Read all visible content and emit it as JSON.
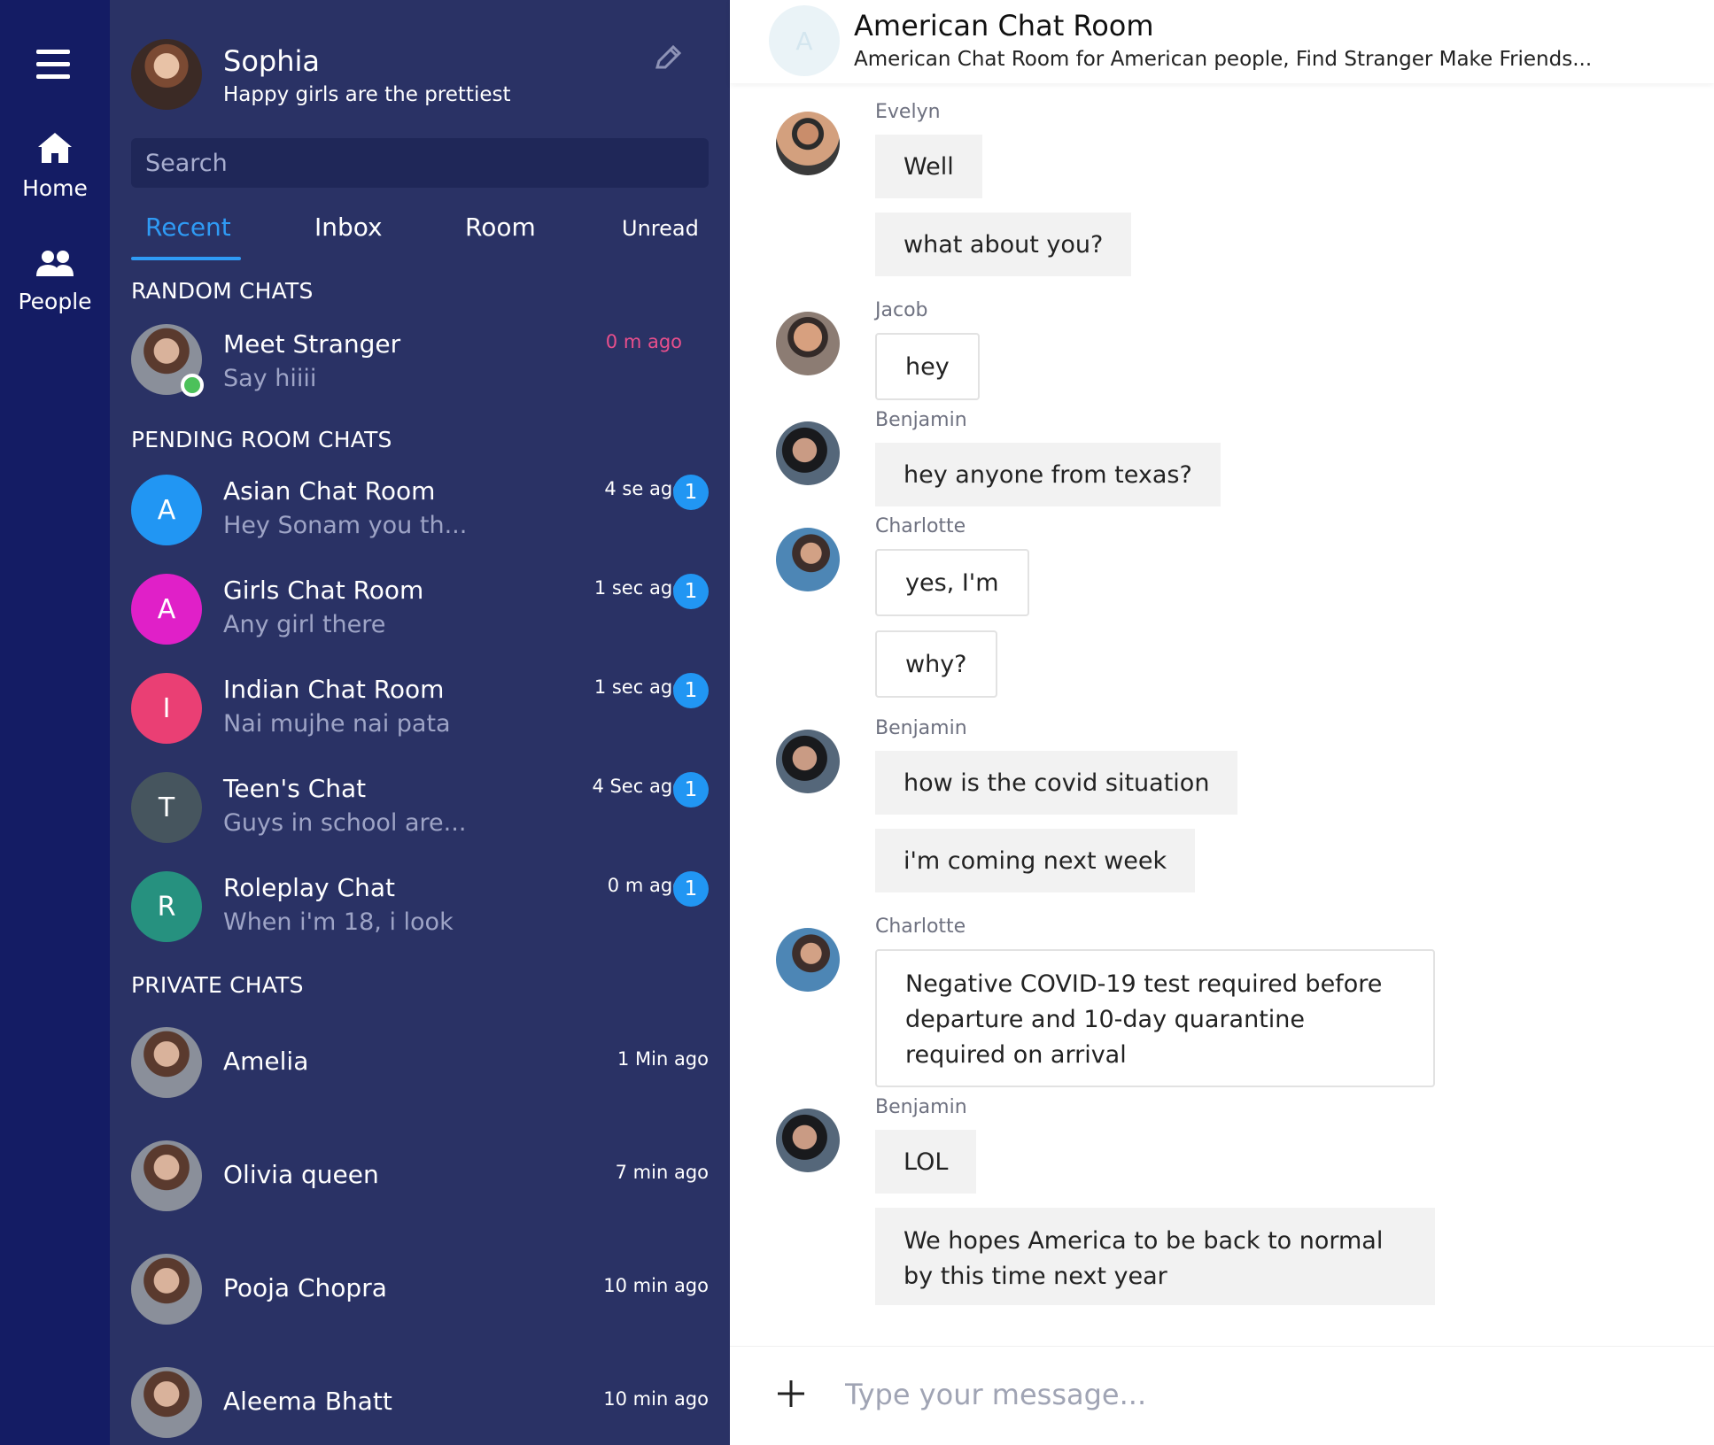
{
  "rail": {
    "home_label": "Home",
    "people_label": "People"
  },
  "profile": {
    "name": "Sophia",
    "status": "Happy girls are the prettiest"
  },
  "search": {
    "placeholder": "Search"
  },
  "tabs": [
    {
      "label": "Recent",
      "active": true
    },
    {
      "label": "Inbox",
      "active": false
    },
    {
      "label": "Room",
      "active": false
    },
    {
      "label": "Unread",
      "active": false
    }
  ],
  "sections": {
    "random": "RANDOM CHATS",
    "pending": "PENDING ROOM CHATS",
    "private": "PRIVATE CHATS"
  },
  "random_chats": [
    {
      "name": "Meet Stranger",
      "message": "Say hiiii",
      "time": "0 m ago",
      "online": true
    }
  ],
  "pending_chats": [
    {
      "initial": "A",
      "name": "Asian Chat Room",
      "message": "Hey Sonam you th...",
      "time": "4 se ago",
      "unread": "1",
      "color": "#2196f3"
    },
    {
      "initial": "A",
      "name": "Girls Chat Room",
      "message": "Any girl there",
      "time": "1 sec ago",
      "unread": "1",
      "color": "#e020c8"
    },
    {
      "initial": "I",
      "name": "Indian Chat Room",
      "message": "Nai mujhe nai pata",
      "time": "1 sec ago",
      "unread": "1",
      "color": "#ea3f74"
    },
    {
      "initial": "T",
      "name": "Teen's Chat",
      "message": "Guys in school are...",
      "time": "4 Sec ago",
      "unread": "1",
      "color": "#46555e"
    },
    {
      "initial": "R",
      "name": "Roleplay Chat",
      "message": "When i'm 18, i look",
      "time": "0 m ago",
      "unread": "1",
      "color": "#26917f"
    }
  ],
  "private_chats": [
    {
      "name": "Amelia",
      "time": "1 Min ago"
    },
    {
      "name": "Olivia queen",
      "time": "7 min ago"
    },
    {
      "name": "Pooja Chopra",
      "time": "10 min ago"
    },
    {
      "name": "Aleema Bhatt",
      "time": "10 min ago"
    }
  ],
  "room": {
    "initial": "A",
    "title": "American Chat Room",
    "description": "American Chat Room for American people, Find Stranger Make Friends..."
  },
  "messages": [
    {
      "sender": "Evelyn",
      "bubbles": [
        "Well",
        "what about you?"
      ]
    },
    {
      "sender": "Jacob",
      "bubbles": [
        "hey"
      ]
    },
    {
      "sender": "Benjamin",
      "bubbles": [
        "hey anyone from texas?"
      ]
    },
    {
      "sender": "Charlotte",
      "bubbles": [
        "yes, I'm",
        "why?"
      ]
    },
    {
      "sender": "Benjamin",
      "bubbles": [
        "how is the covid situation",
        "i'm coming next week"
      ]
    },
    {
      "sender": "Charlotte",
      "bubbles": [
        "Negative COVID-19 test required before departure and 10-day quarantine required on arrival"
      ]
    },
    {
      "sender": "Benjamin",
      "bubbles": [
        "LOL",
        "We hopes America to be back to normal by this time next year"
      ]
    }
  ],
  "composer": {
    "placeholder": "Type your message..."
  },
  "colors": {
    "rail": "#141c64",
    "panel": "#2a3265",
    "accent": "#2f9bf5",
    "badge": "#2196f3",
    "recent_time": "#e94f8c",
    "online": "#4cc15a"
  }
}
